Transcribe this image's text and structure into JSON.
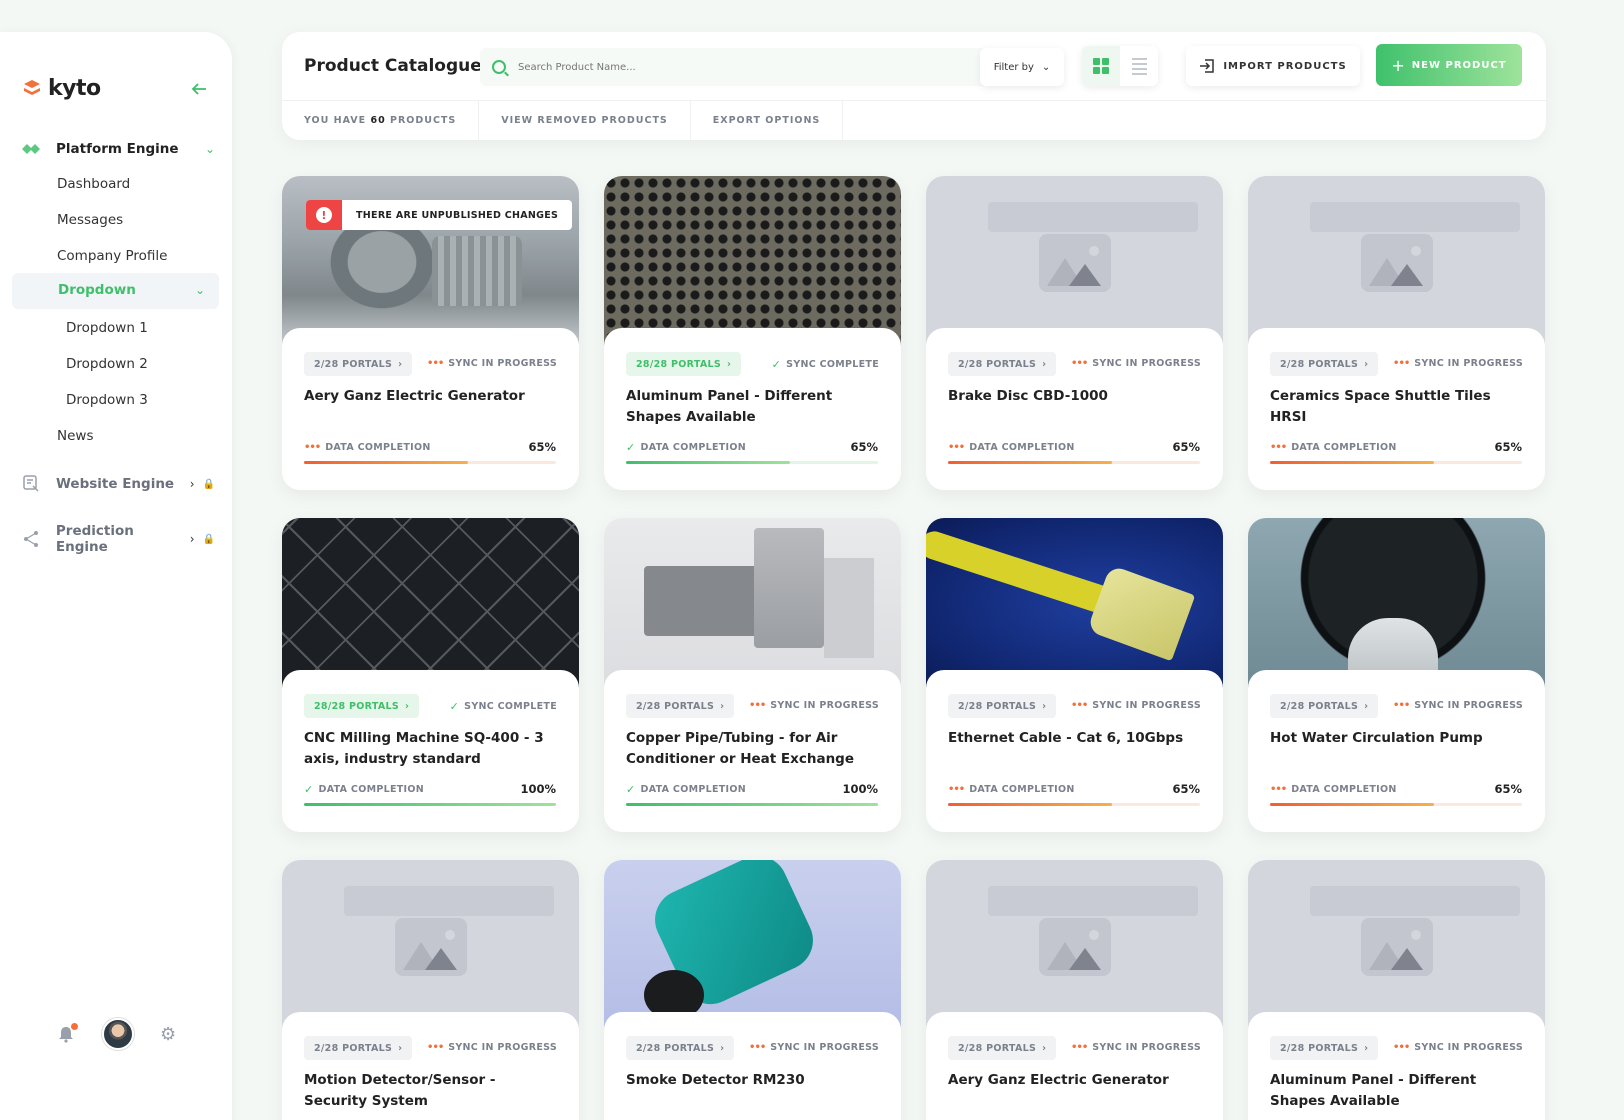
{
  "brand": {
    "name": "kyto",
    "accent": "#3fbf6a",
    "warning": "#f3703a"
  },
  "sidebar": {
    "sections": [
      {
        "label": "Platform Engine",
        "icon": "platform-icon"
      },
      {
        "label": "Website Engine",
        "icon": "website-icon",
        "locked": true
      },
      {
        "label": "Prediction Engine",
        "icon": "share-icon",
        "locked": true
      }
    ],
    "items": [
      "Dashboard",
      "Messages",
      "Company Profile"
    ],
    "active": "Dropdown",
    "subitems": [
      "Dropdown 1",
      "Dropdown 2",
      "Dropdown 3"
    ],
    "news": "News"
  },
  "header": {
    "title": "Product Catalogue",
    "search_placeholder": "Search Product Name...",
    "filter_label": "Filter by",
    "import_label": "IMPORT PRODUCTS",
    "new_label": "NEW PRODUCT",
    "tabs": {
      "count_prefix": "YOU HAVE",
      "count": "60",
      "count_suffix": "PRODUCTS",
      "removed": "VIEW REMOVED PRODUCTS",
      "export": "EXPORT OPTIONS"
    }
  },
  "labels": {
    "data_completion": "DATA COMPLETION",
    "alert": "THERE ARE UNPUBLISHED CHANGES"
  },
  "products": [
    {
      "name": "Aery Ganz Electric Generator",
      "portals": "2/28 PORTALS",
      "sync": "SYNC IN PROGRESS",
      "completion": "65%",
      "progress": 0.65,
      "complete": false,
      "image": "generator",
      "alert": true
    },
    {
      "name": "Aluminum Panel - Different Shapes Available",
      "portals": "28/28 PORTALS",
      "sync": "SYNC COMPLETE",
      "completion": "65%",
      "progress": 0.65,
      "complete": true,
      "image": "mesh"
    },
    {
      "name": "Brake Disc CBD-1000",
      "portals": "2/28 PORTALS",
      "sync": "SYNC IN PROGRESS",
      "completion": "65%",
      "progress": 0.65,
      "complete": false,
      "image": "placeholder"
    },
    {
      "name": "Ceramics Space Shuttle Tiles HRSI",
      "portals": "2/28 PORTALS",
      "sync": "SYNC IN PROGRESS",
      "completion": "65%",
      "progress": 0.65,
      "complete": false,
      "image": "placeholder"
    },
    {
      "name": "CNC Milling Machine SQ-400 - 3 axis, industry standard",
      "portals": "28/28 PORTALS",
      "sync": "SYNC COMPLETE",
      "completion": "100%",
      "progress": 1.0,
      "complete": true,
      "image": "board"
    },
    {
      "name": "Copper Pipe/Tubing - for Air Conditioner or Heat Exchange",
      "portals": "2/28 PORTALS",
      "sync": "SYNC IN PROGRESS",
      "completion": "100%",
      "progress": 1.0,
      "complete": false,
      "dc_complete": true,
      "image": "cnc"
    },
    {
      "name": "Ethernet Cable - Cat 6, 10Gbps",
      "portals": "2/28 PORTALS",
      "sync": "SYNC IN PROGRESS",
      "completion": "65%",
      "progress": 0.65,
      "complete": false,
      "image": "cable"
    },
    {
      "name": "Hot Water Circulation Pump",
      "portals": "2/28 PORTALS",
      "sync": "SYNC IN PROGRESS",
      "completion": "65%",
      "progress": 0.65,
      "complete": false,
      "image": "pump-dark"
    },
    {
      "name": "Motion Detector/Sensor - Security System",
      "portals": "2/28 PORTALS",
      "sync": "SYNC IN PROGRESS",
      "completion": "",
      "progress": 0,
      "complete": false,
      "image": "placeholder"
    },
    {
      "name": "Smoke Detector RM230",
      "portals": "2/28 PORTALS",
      "sync": "SYNC IN PROGRESS",
      "completion": "",
      "progress": 0,
      "complete": false,
      "image": "pump-teal"
    },
    {
      "name": "Aery Ganz Electric Generator",
      "portals": "2/28 PORTALS",
      "sync": "SYNC IN PROGRESS",
      "completion": "",
      "progress": 0,
      "complete": false,
      "image": "placeholder"
    },
    {
      "name": "Aluminum Panel - Different Shapes Available",
      "portals": "2/28 PORTALS",
      "sync": "SYNC IN PROGRESS",
      "completion": "",
      "progress": 0,
      "complete": false,
      "image": "placeholder"
    }
  ]
}
